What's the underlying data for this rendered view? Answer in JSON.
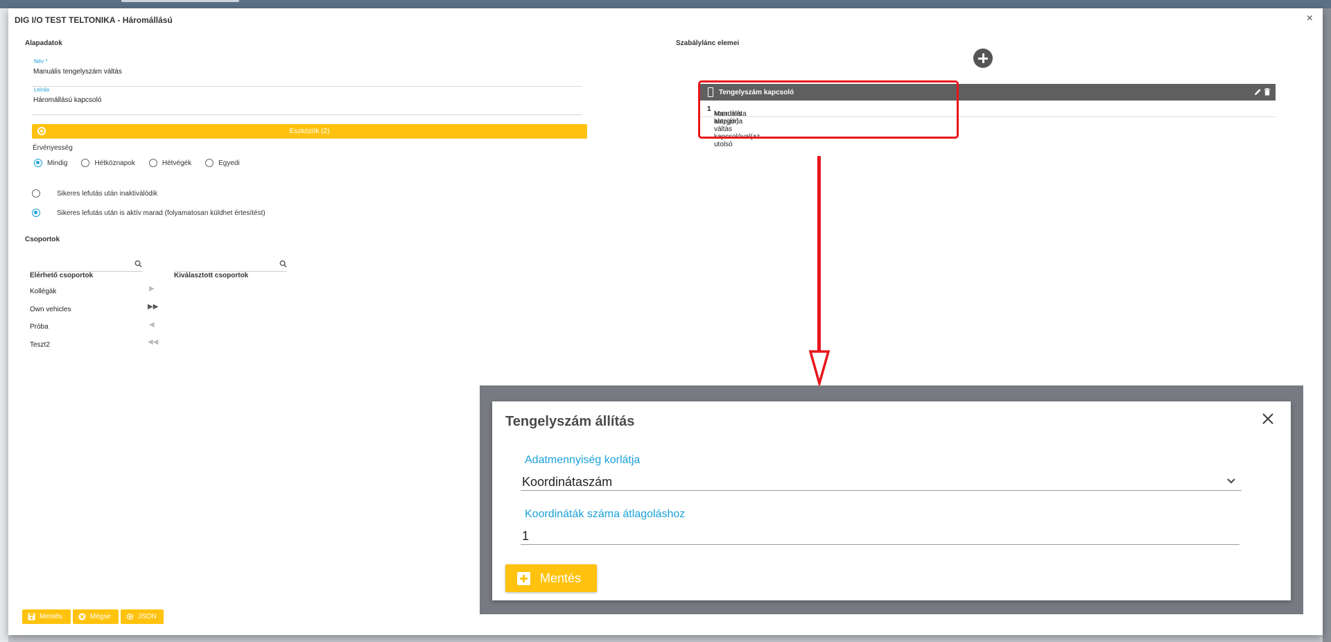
{
  "dialog": {
    "title": "DIG I/O TEST TELTONIKA - Háromállású",
    "close_glyph": "×"
  },
  "basic": {
    "section_title": "Alapadatok",
    "name_label": "Név *",
    "name_value": "Manuális tengelyszám váltás",
    "desc_label": "Leírás",
    "desc_value": "Háromállású kapcsoló",
    "tools_button": "Eszközök (2)"
  },
  "validity": {
    "label": "Érvényesség",
    "options": [
      "Mindig",
      "Hétköznapok",
      "Hétvégék",
      "Egyedi"
    ],
    "selected": "Mindig"
  },
  "run_mode": {
    "options": [
      "Sikeres lefutás után inaktiválódik",
      "Sikeres lefutás után is aktív marad (folyamatosan küldhet értesítést)"
    ],
    "selected_index": 1
  },
  "groups": {
    "section_title": "Csoportok",
    "available_header": "Elérhető csoportok",
    "selected_header": "Kiválasztott csoportok",
    "available_items": [
      "Kollégák",
      "Own vehicles",
      "Próba",
      "Teszt2"
    ],
    "move_buttons": [
      "▶",
      "▶▶",
      "◀",
      "◀◀"
    ]
  },
  "bottom_buttons": {
    "save": "Mentés",
    "cancel": "Mégse",
    "json": "JSON"
  },
  "chain": {
    "section_title": "Szabálylánc elemei",
    "card_title": "Tengelyszám kapcsoló",
    "card_body_prefix": "Manuális kategória váltás kapcsolóval(az utolsó ",
    "card_body_bold": "1",
    "card_body_suffix": " koordináta alapján)"
  },
  "modal": {
    "title": "Tengelyszám állítás",
    "field1_label": "Adatmennyiség korlátja",
    "field1_value": "Koordinátaszám",
    "field2_label": "Koordináták száma átlagoláshoz",
    "field2_value": "1",
    "save_button": "Mentés"
  },
  "colors": {
    "accent": "#ffc20e",
    "link_blue": "#1aa0d8",
    "highlight_red": "#e8141b",
    "card_header": "#5f5f5f"
  }
}
